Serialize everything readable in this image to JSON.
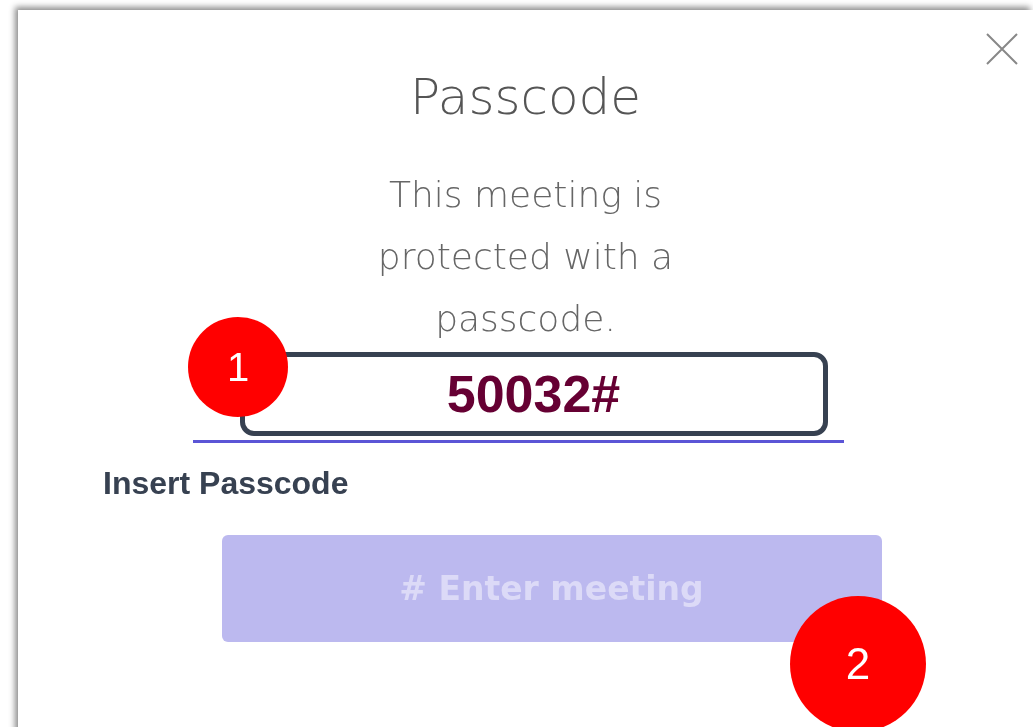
{
  "dialog": {
    "title": "Passcode",
    "message": "This meeting is protected with a passcode.",
    "passcode_field": {
      "value": "50032#",
      "highlighted": true
    },
    "field_label": "Insert Passcode",
    "enter_button": {
      "label": "# Enter meeting",
      "disabled": true
    }
  },
  "annotations": [
    {
      "label": "1"
    },
    {
      "label": "2"
    }
  ]
}
